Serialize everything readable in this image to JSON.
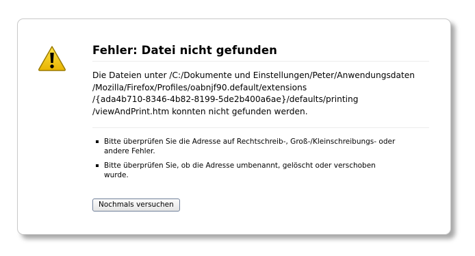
{
  "error": {
    "title": "Fehler: Datei nicht gefunden",
    "description_lines": [
      "Die Dateien unter /C:/Dokumente und Einstellungen/Peter/Anwendungsdaten",
      "/Mozilla/Firefox/Profiles/oabnjf90.default/extensions",
      "/{ada4b710-8346-4b82-8199-5de2b400a6ae}/defaults/printing",
      "/viewAndPrint.htm konnten nicht gefunden werden."
    ],
    "suggestions": [
      "Bitte überprüfen Sie die Adresse auf Rechtschreib-, Groß-/Kleinschreibungs- oder andere Fehler.",
      "Bitte überprüfen Sie, ob die Adresse umbenannt, gelöscht oder verschoben wurde."
    ],
    "retry_label": "Nochmals versuchen",
    "icon": "warning-icon",
    "icon_color": "#f5c400"
  }
}
